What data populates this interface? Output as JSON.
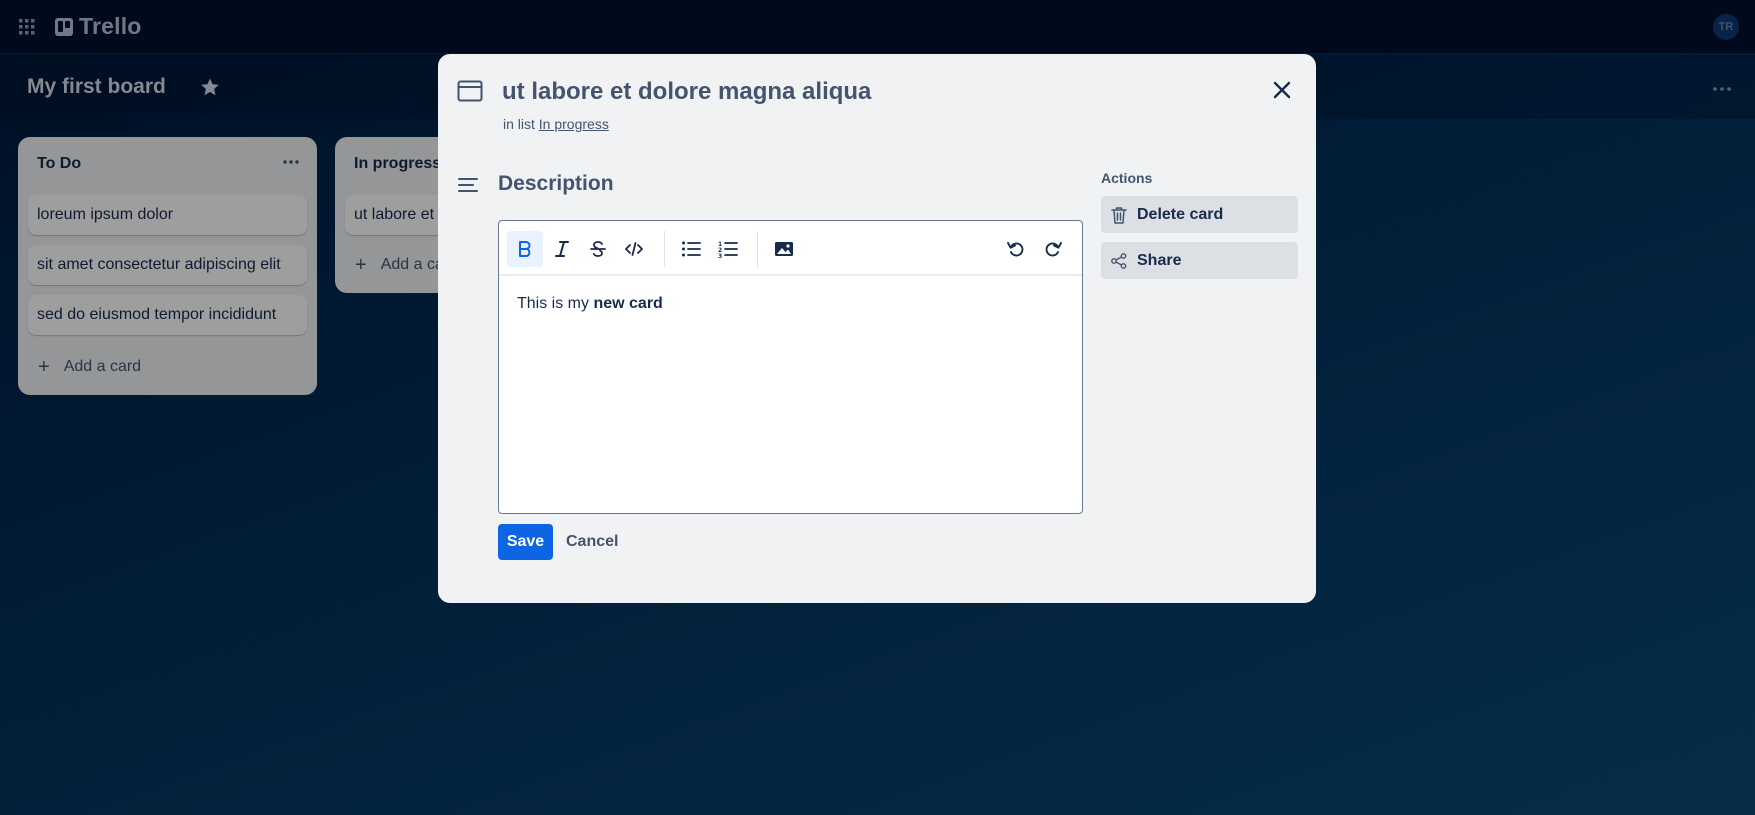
{
  "app": {
    "name": "Trello",
    "avatar_initials": "TR"
  },
  "board": {
    "title": "My first board"
  },
  "lists": [
    {
      "title": "To Do",
      "cards": [
        "loreum ipsum dolor",
        "sit amet consectetur adipiscing elit",
        "sed do eiusmod tempor incididunt"
      ],
      "add_label": "Add a card"
    },
    {
      "title": "In progress",
      "cards": [
        "ut labore et dolore magna aliqua"
      ],
      "add_label": "Add a card"
    }
  ],
  "modal": {
    "title": "ut labore et dolore magna aliqua",
    "in_list_prefix": "in list",
    "in_list_name": "In progress",
    "description_title": "Description",
    "editor_text_plain": "This is my ",
    "editor_text_bold": "new card",
    "save_label": "Save",
    "cancel_label": "Cancel",
    "actions_title": "Actions",
    "delete_label": "Delete card",
    "share_label": "Share"
  },
  "colors": {
    "accent": "#0c66e4",
    "topbar": "#00112e",
    "list_bg": "#f1f2f4"
  },
  "icons": [
    "apps-grid-icon",
    "trello-logo-icon",
    "star-icon",
    "more-icon",
    "card-icon",
    "close-icon",
    "description-icon",
    "bold-icon",
    "italic-icon",
    "strikethrough-icon",
    "code-icon",
    "bullet-list-icon",
    "numbered-list-icon",
    "image-icon",
    "undo-icon",
    "redo-icon",
    "trash-icon",
    "share-icon"
  ]
}
